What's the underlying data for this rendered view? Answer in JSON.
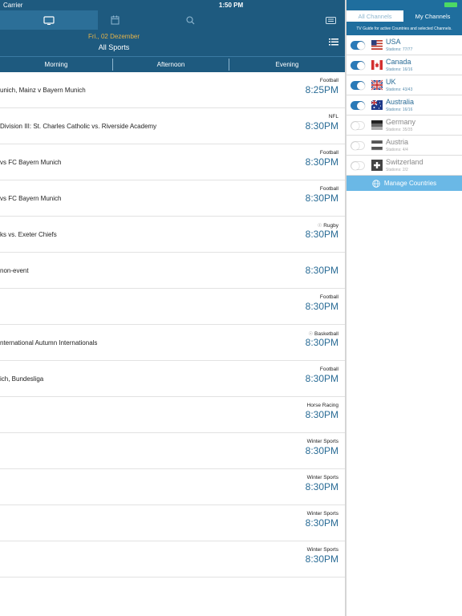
{
  "status": {
    "carrier": "Carrier",
    "time": "1:50 PM"
  },
  "header": {
    "date": "Fri., 02 Dezember",
    "sport": "All Sports"
  },
  "timebar": [
    "Morning",
    "Afternoon",
    "Evening"
  ],
  "events": [
    {
      "title": "unich, Mainz v Bayern Munich",
      "sport": "Football",
      "time": "8:25PM"
    },
    {
      "title": "Division III: St. Charles Catholic vs. Riverside Academy",
      "sport": "NFL",
      "time": "8:30PM"
    },
    {
      "title": "vs FC Bayern Munich",
      "sport": "Football",
      "time": "8:30PM"
    },
    {
      "title": "vs FC Bayern Munich",
      "sport": "Football",
      "time": "8:30PM"
    },
    {
      "title": "ks vs. Exeter Chiefs",
      "sport": "Rugby",
      "time": "8:30PM"
    },
    {
      "title": "non-event",
      "sport": "",
      "time": "8:30PM"
    },
    {
      "title": "",
      "sport": "Football",
      "time": "8:30PM"
    },
    {
      "title": "nternational Autumn Internationals",
      "sport": "Basketball",
      "time": "8:30PM"
    },
    {
      "title": "ich, Bundesliga",
      "sport": "Football",
      "time": "8:30PM"
    },
    {
      "title": "",
      "sport": "Horse Racing",
      "time": "8:30PM"
    },
    {
      "title": "",
      "sport": "Winter Sports",
      "time": "8:30PM"
    },
    {
      "title": "",
      "sport": "Winter Sports",
      "time": "8:30PM"
    },
    {
      "title": "",
      "sport": "Winter Sports",
      "time": "8:30PM"
    },
    {
      "title": "",
      "sport": "Winter Sports",
      "time": "8:30PM"
    }
  ],
  "side": {
    "tab_all": "All Channels",
    "tab_my": "My Channels",
    "subtitle": "TV Guide for active Countries and selected Channels.",
    "countries": [
      {
        "name": "USA",
        "stations": "Stations: 77/77",
        "on": true,
        "flag": "usa-flag"
      },
      {
        "name": "Canada",
        "stations": "Stations: 16/16",
        "on": true,
        "flag": "canada-flag"
      },
      {
        "name": "UK",
        "stations": "Stations: 43/43",
        "on": true,
        "flag": "uk-flag"
      },
      {
        "name": "Australia",
        "stations": "Stations: 16/16",
        "on": true,
        "flag": "australia-flag"
      },
      {
        "name": "Germany",
        "stations": "Stations: 35/35",
        "on": false,
        "flag": "germany-flag"
      },
      {
        "name": "Austria",
        "stations": "Stations: 4/4",
        "on": false,
        "flag": "austria-flag"
      },
      {
        "name": "Switzerland",
        "stations": "Stations: 2/2",
        "on": false,
        "flag": "switzerland-flag"
      }
    ],
    "manage": "Manage Countries"
  },
  "colors": {
    "header_blue": "#1e5a7f",
    "accent_blue": "#2a6c96",
    "date_gold": "#e3b24a",
    "manage_blue": "#6ab8e6"
  }
}
